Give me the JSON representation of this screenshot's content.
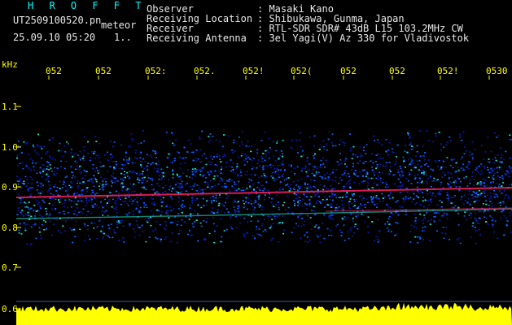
{
  "header": {
    "program": "H R O F F T",
    "filename": "UT2509100520.pn",
    "tag": "meteor",
    "timestamp": "25.09.10 05:20",
    "index": "1..",
    "fields": [
      {
        "label": "Observer",
        "value": ": Masaki Kano"
      },
      {
        "label": "Receiving Location",
        "value": ": Shibukawa, Gunma, Japan"
      },
      {
        "label": "Receiver",
        "value": ": RTL-SDR SDR# 43dB L15 103.2MHz CW"
      },
      {
        "label": "Receiving Antenna",
        "value": ": 3el Yagi(V) Az 330 for Vladivostok"
      }
    ]
  },
  "axis": {
    "unit": "kHz",
    "y_ticks": [
      "1.1",
      "1.0",
      "0.9",
      "0.8",
      "0.7",
      "0.6"
    ],
    "x_ticks": [
      "052",
      "052",
      "052:",
      "052.",
      "052!",
      "052(",
      "052",
      "052",
      "052!",
      "0530"
    ]
  },
  "colors": {
    "background": "#000000",
    "text": "#e8e8e8",
    "tick_text": "#ffff00",
    "title": "#00ffff",
    "noise_low": "#0a1aa0",
    "noise_mid": "#1060ff",
    "noise_high": "#20e0c0",
    "signal": "#ff2060",
    "power_trace": "#ffff00"
  }
}
